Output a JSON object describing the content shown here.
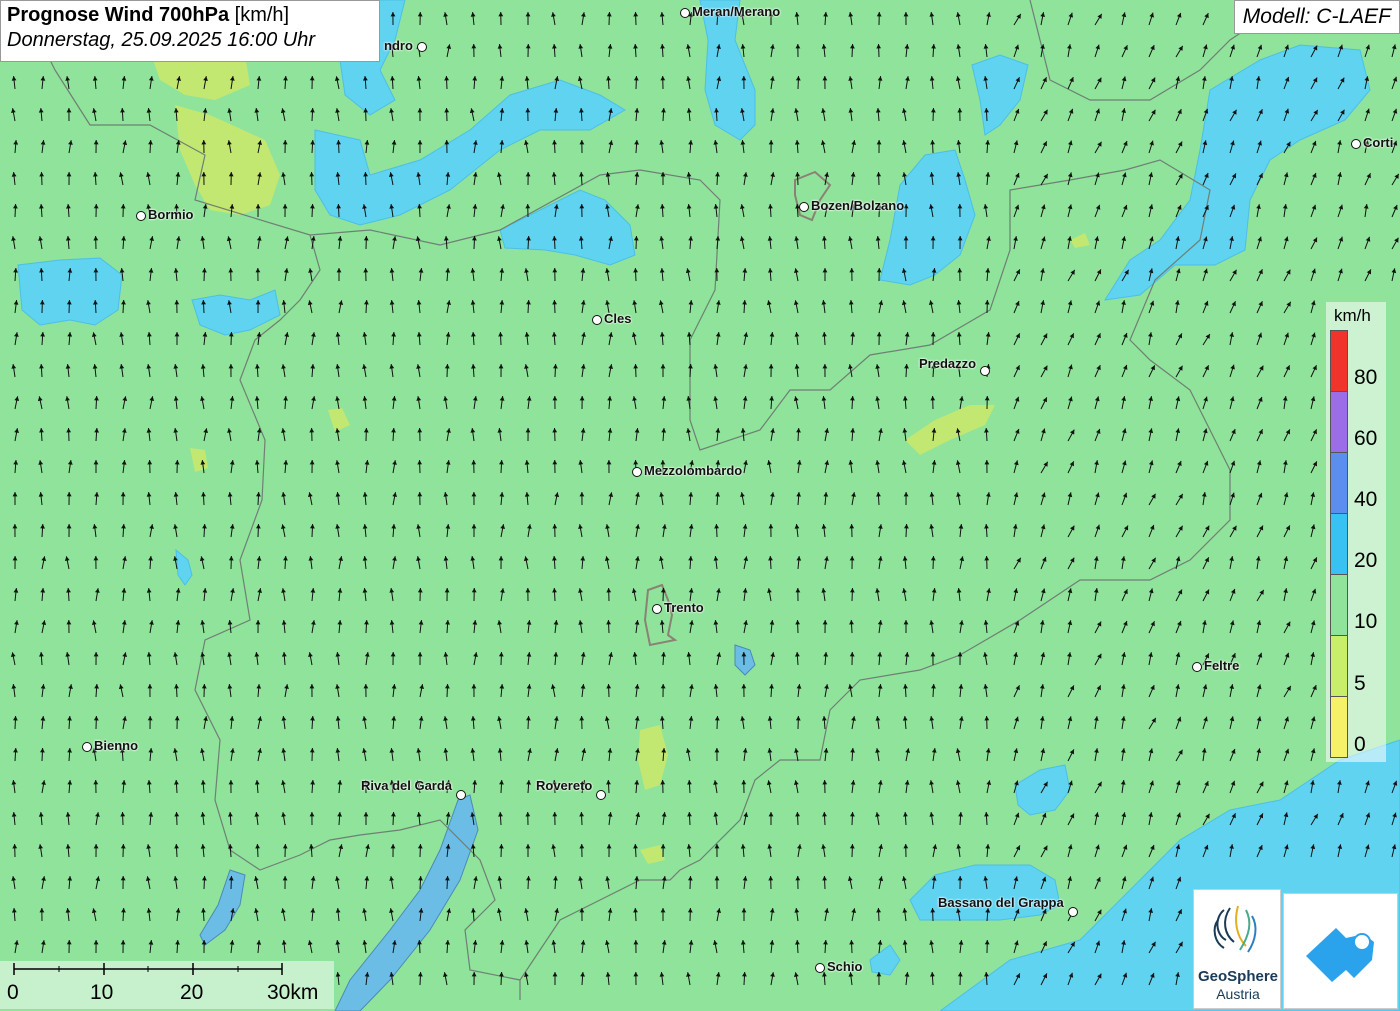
{
  "header": {
    "title_bold": "Prognose Wind 700hPa",
    "title_unit": "[km/h]",
    "datetime": "Donnerstag, 25.09.2025 16:00 Uhr"
  },
  "model": {
    "label": "Modell: C-LAEF"
  },
  "legend": {
    "unit": "km/h",
    "labels": [
      "80",
      "60",
      "40",
      "20",
      "10",
      "5",
      "0"
    ],
    "colors": {
      "c80": "#f0332b",
      "c60": "#9b6ee8",
      "c40": "#5c8ef0",
      "c20": "#38c2f4",
      "c10": "#8fe39a",
      "c5": "#c9ee6a",
      "c0": "#f5f26a"
    }
  },
  "scale_bar": {
    "labels": [
      "0",
      "10",
      "20",
      "30km"
    ]
  },
  "cities": [
    {
      "name": "Meran/Merano"
    },
    {
      "name": "ndro"
    },
    {
      "name": "Bormio"
    },
    {
      "name": "Bozen/Bolzano"
    },
    {
      "name": "Corti"
    },
    {
      "name": "Cles"
    },
    {
      "name": "Predazzo"
    },
    {
      "name": "Mezzolombardo"
    },
    {
      "name": "Trento"
    },
    {
      "name": "Feltre"
    },
    {
      "name": "Bienno"
    },
    {
      "name": "Riva del Garda"
    },
    {
      "name": "Rovereto"
    },
    {
      "name": "Bassano del Grappa"
    },
    {
      "name": "Schio"
    }
  ],
  "logos": {
    "geosphere_line1": "GeoSphere",
    "geosphere_line2": "Austria"
  }
}
